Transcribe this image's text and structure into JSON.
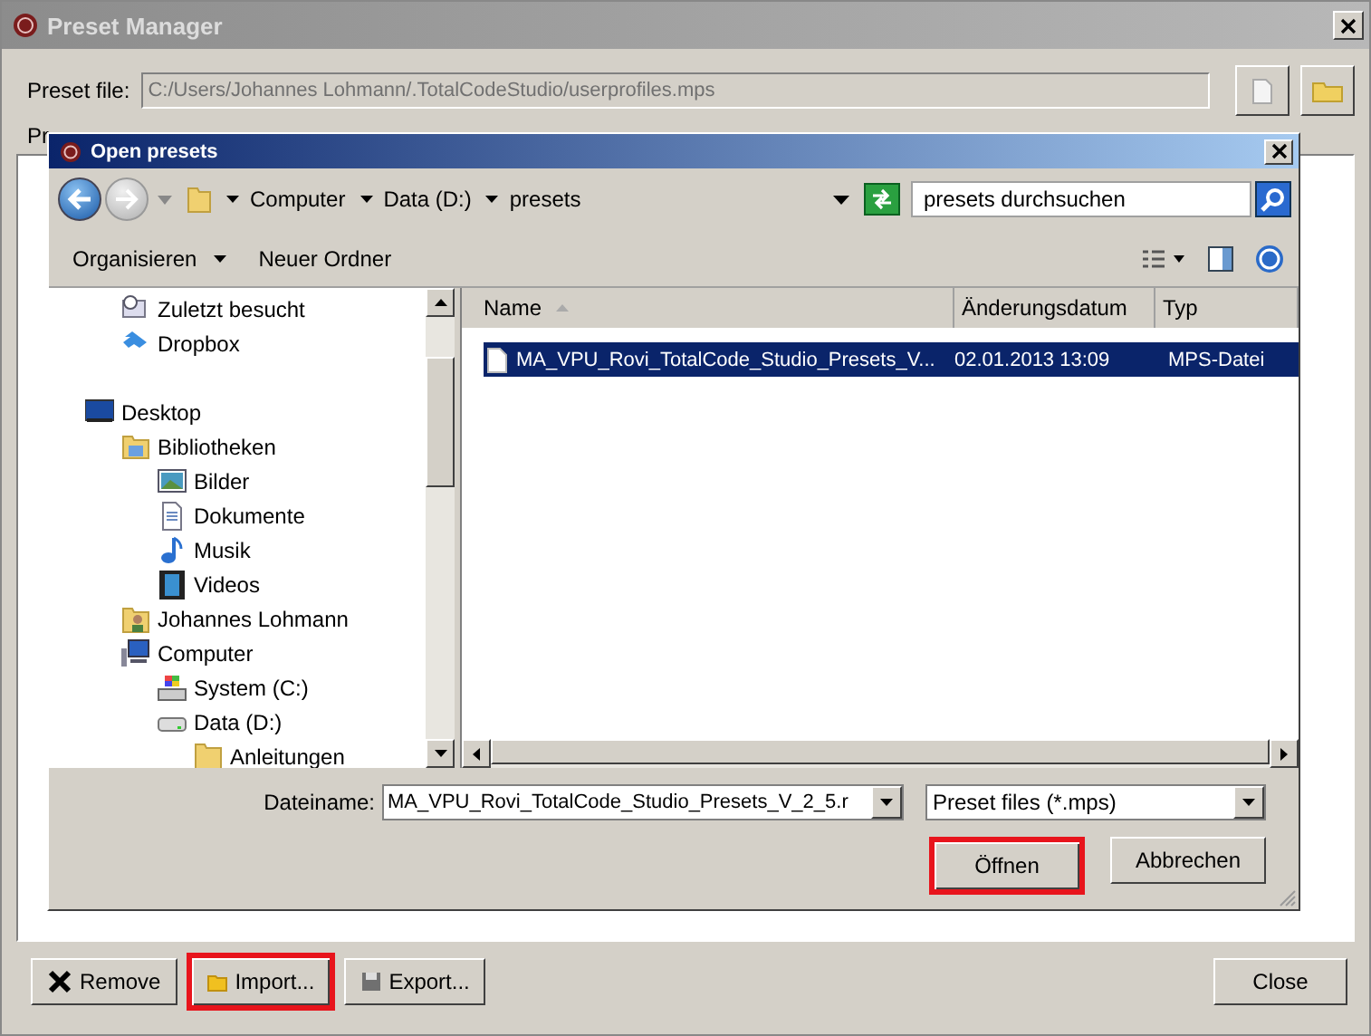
{
  "main_window": {
    "title": "Preset Manager",
    "preset_file_label": "Preset file:",
    "preset_file_value": "C:/Users/Johannes Lohmann/.TotalCodeStudio/userprofiles.mps",
    "presets_label": "Pr",
    "buttons": [
      {
        "kind": "remove",
        "label": "Remove",
        "highlighted": false
      },
      {
        "kind": "import",
        "label": "Import...",
        "highlighted": true
      },
      {
        "kind": "export",
        "label": "Export...",
        "highlighted": false
      },
      {
        "kind": "close",
        "label": "Close",
        "highlighted": false
      }
    ]
  },
  "dialog": {
    "title": "Open presets",
    "breadcrumb": [
      "Computer",
      "Data (D:)",
      "presets"
    ],
    "search": {
      "placeholder": "presets durchsuchen"
    },
    "toolbar": [
      {
        "label": "Organisieren",
        "dropdown": true
      },
      {
        "label": "Neuer Ordner",
        "dropdown": false
      }
    ],
    "nav_sections": [
      {
        "kind": "favorites",
        "items": [
          {
            "label": "Zuletzt besucht",
            "kind": "recent"
          },
          {
            "label": "Dropbox",
            "kind": "dropbox"
          }
        ]
      },
      {
        "kind": "tree",
        "items": [
          {
            "label": "Desktop",
            "kind": "desktop",
            "children": [
              {
                "label": "Bibliotheken",
                "kind": "library",
                "children": [
                  {
                    "label": "Bilder",
                    "kind": "pictures"
                  },
                  {
                    "label": "Dokumente",
                    "kind": "documents"
                  },
                  {
                    "label": "Musik",
                    "kind": "music"
                  },
                  {
                    "label": "Videos",
                    "kind": "videos"
                  }
                ]
              },
              {
                "label": "Johannes Lohmann",
                "kind": "user"
              },
              {
                "label": "Computer",
                "kind": "computer",
                "children": [
                  {
                    "label": "System (C:)",
                    "kind": "drive-system"
                  },
                  {
                    "label": "Data (D:)",
                    "kind": "drive",
                    "children": [
                      {
                        "label": "Anleitungen",
                        "kind": "folder"
                      }
                    ]
                  }
                ]
              }
            ]
          }
        ]
      }
    ],
    "columns": [
      {
        "label": "Name",
        "sorted": true
      },
      {
        "label": "Änderungsdatum",
        "sorted": false
      },
      {
        "label": "Typ",
        "sorted": false
      }
    ],
    "files": [
      {
        "name": "MA_VPU_Rovi_TotalCode_Studio_Presets_V...",
        "date": "02.01.2013 13:09",
        "type": "MPS-Datei",
        "selected": true
      }
    ],
    "filename_label": "Dateiname:",
    "filename_value": "MA_VPU_Rovi_TotalCode_Studio_Presets_V_2_5.r",
    "filetype": "Preset files (*.mps)",
    "buttons": [
      {
        "label": "Öffnen",
        "highlighted": true
      },
      {
        "label": "Abbrechen",
        "highlighted": false
      }
    ]
  }
}
